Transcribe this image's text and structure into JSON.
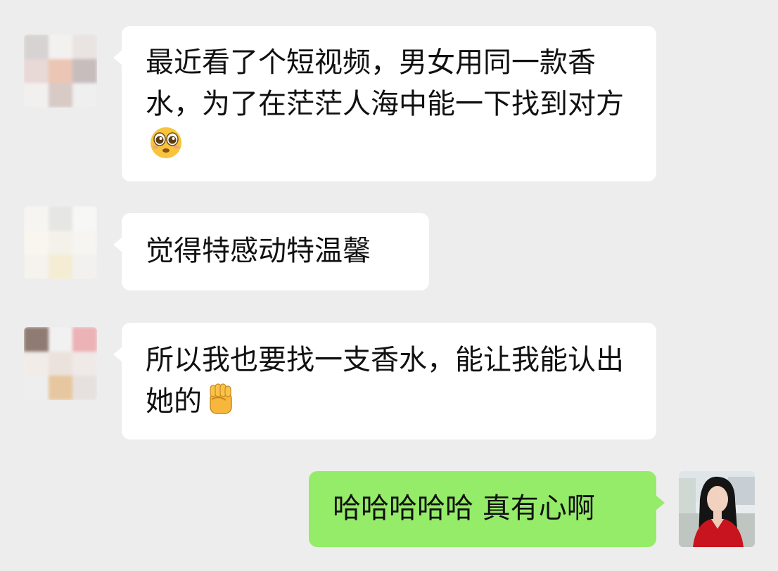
{
  "messages": [
    {
      "sender": "other",
      "text": "最近看了个短视频，男女用同一款香水，为了在茫茫人海中能一下找到对方",
      "emoji": "pleading-face-icon"
    },
    {
      "sender": "other",
      "text": "觉得特感动特温馨",
      "emoji": ""
    },
    {
      "sender": "other",
      "text": "所以我也要找一支香水，能让我能认出她的",
      "emoji": "raised-fist-icon"
    },
    {
      "sender": "self",
      "text": "哈哈哈哈哈 真有心啊",
      "emoji": ""
    }
  ],
  "colors": {
    "background": "#ededed",
    "incoming_bubble": "#ffffff",
    "outgoing_bubble": "#95ec69"
  }
}
